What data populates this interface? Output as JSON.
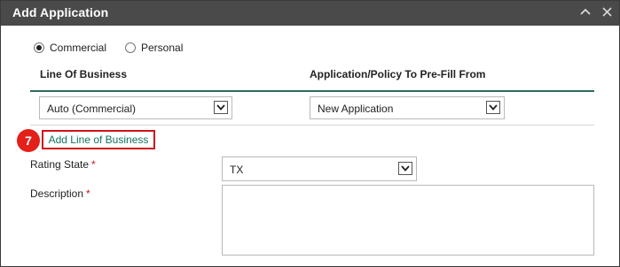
{
  "dialog": {
    "title": "Add Application"
  },
  "account_type": {
    "options": [
      {
        "label": "Commercial",
        "checked": true
      },
      {
        "label": "Personal",
        "checked": false
      }
    ]
  },
  "columns": {
    "line_of_business": "Line Of Business",
    "prefill_from": "Application/Policy To Pre-Fill From"
  },
  "row": {
    "line_of_business_value": "Auto (Commercial)",
    "prefill_value": "New Application"
  },
  "step_badge": "7",
  "add_line_of_business_label": "Add Line of Business",
  "rating_state": {
    "label": "Rating State",
    "required_mark": "*",
    "value": "TX"
  },
  "description": {
    "label": "Description",
    "required_mark": "*",
    "value": ""
  },
  "colors": {
    "titlebar": "#4a4a4a",
    "accent_green": "#2e6b5e",
    "link_green": "#137360",
    "highlight_red": "#d0121a"
  }
}
